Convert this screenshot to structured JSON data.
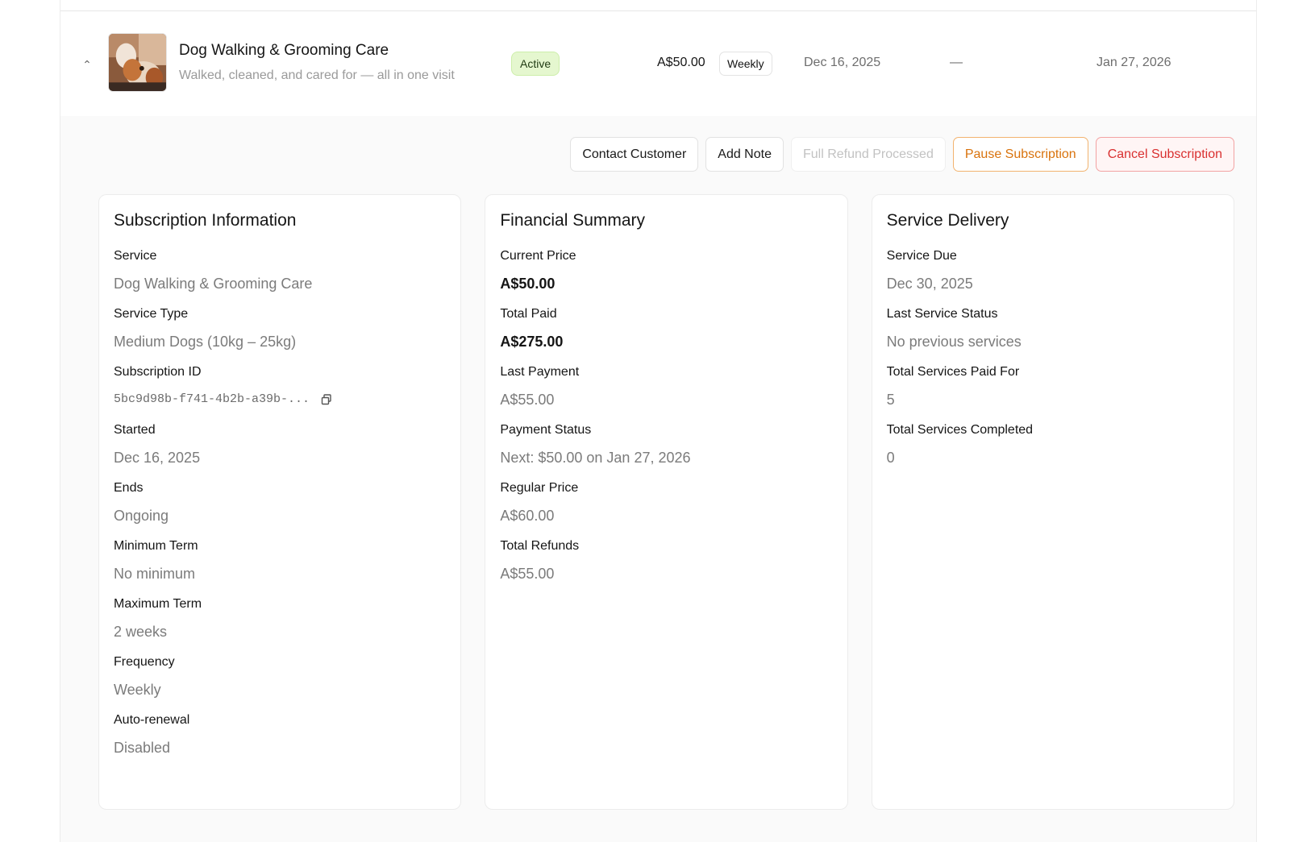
{
  "row": {
    "title": "Dog Walking & Grooming Care",
    "subtitle": "Walked, cleaned, and cared for — all in one visit",
    "status": "Active",
    "price": "A$50.00",
    "frequency": "Weekly",
    "start_date": "Dec 16, 2025",
    "end_date": "—",
    "next_date": "Jan 27, 2026",
    "thumbnail_icon": "dog-photo",
    "expand_icon": "chevron-up-icon"
  },
  "actions": {
    "contact": "Contact Customer",
    "add_note": "Add Note",
    "refund": "Full Refund Processed",
    "pause": "Pause Subscription",
    "cancel": "Cancel Subscription"
  },
  "subscription": {
    "title": "Subscription Information",
    "fields": [
      {
        "label": "Service",
        "value": "Dog Walking & Grooming Care"
      },
      {
        "label": "Service Type",
        "value": "Medium Dogs (10kg – 25kg)"
      },
      {
        "label": "Subscription ID",
        "value": "5bc9d98b-f741-4b2b-a39b-..."
      },
      {
        "label": "Started",
        "value": "Dec 16, 2025"
      },
      {
        "label": "Ends",
        "value": "Ongoing"
      },
      {
        "label": "Minimum Term",
        "value": "No minimum"
      },
      {
        "label": "Maximum Term",
        "value": "2 weeks"
      },
      {
        "label": "Frequency",
        "value": "Weekly"
      },
      {
        "label": "Auto-renewal",
        "value": "Disabled"
      }
    ]
  },
  "financial": {
    "title": "Financial Summary",
    "fields": [
      {
        "label": "Current Price",
        "value": "A$50.00"
      },
      {
        "label": "Total Paid",
        "value": "A$275.00"
      },
      {
        "label": "Last Payment",
        "value": "A$55.00"
      },
      {
        "label": "Payment Status",
        "value": "Next: $50.00 on Jan 27, 2026"
      },
      {
        "label": "Regular Price",
        "value": "A$60.00"
      },
      {
        "label": "Total Refunds",
        "value": "A$55.00"
      }
    ]
  },
  "delivery": {
    "title": "Service Delivery",
    "fields": [
      {
        "label": "Service Due",
        "value": "Dec 30, 2025"
      },
      {
        "label": "Last Service Status",
        "value": "No previous services"
      },
      {
        "label": "Total Services Paid For",
        "value": "5"
      },
      {
        "label": "Total Services Completed",
        "value": "0"
      }
    ]
  },
  "colors": {
    "active_badge_bg": "#e5f7cf",
    "pause_accent": "#d9730d",
    "cancel_accent": "#d93030"
  }
}
